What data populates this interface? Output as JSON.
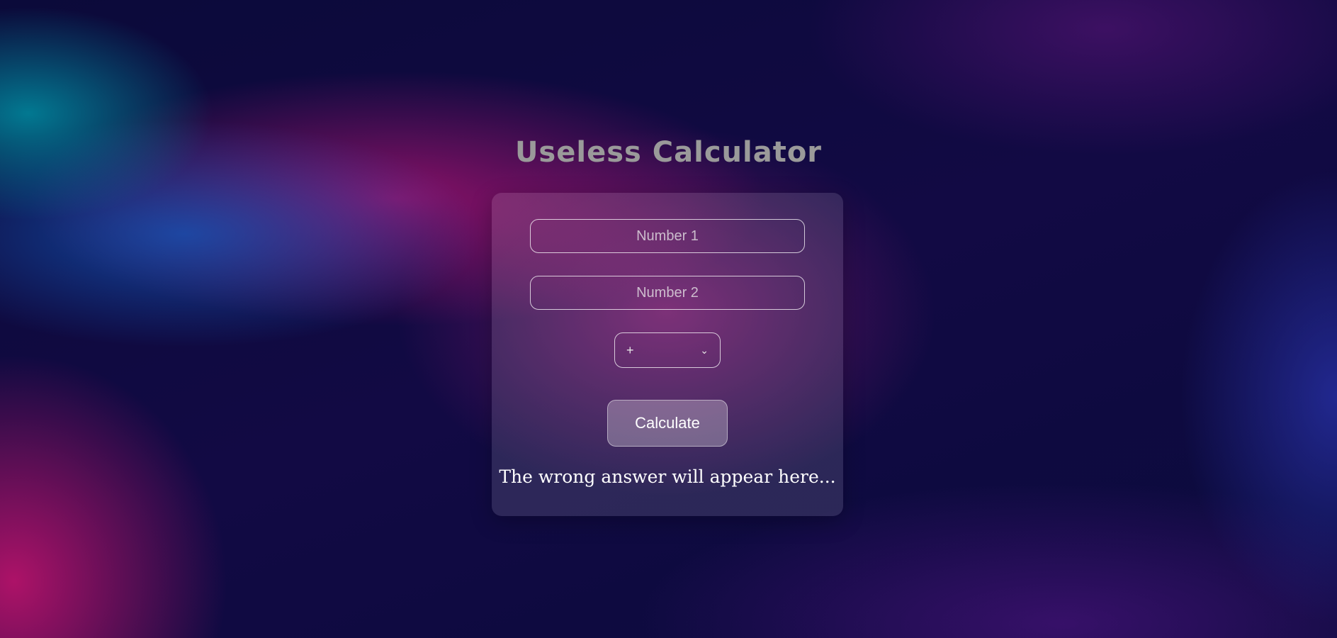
{
  "app": {
    "title": "Useless Calculator"
  },
  "form": {
    "number1": {
      "value": "",
      "placeholder": "Number 1"
    },
    "number2": {
      "value": "",
      "placeholder": "Number 2"
    },
    "operator": {
      "selected": "+"
    },
    "calculate_label": "Calculate",
    "result_text": "The wrong answer will appear here..."
  },
  "icons": {
    "operator_dropdown": "chevron-down-icon"
  },
  "colors": {
    "title": "#9a9a9a",
    "text": "#ffffff",
    "background": "#0c0a3a",
    "accent_pink": "#c8146e",
    "accent_blue": "#145abe"
  }
}
